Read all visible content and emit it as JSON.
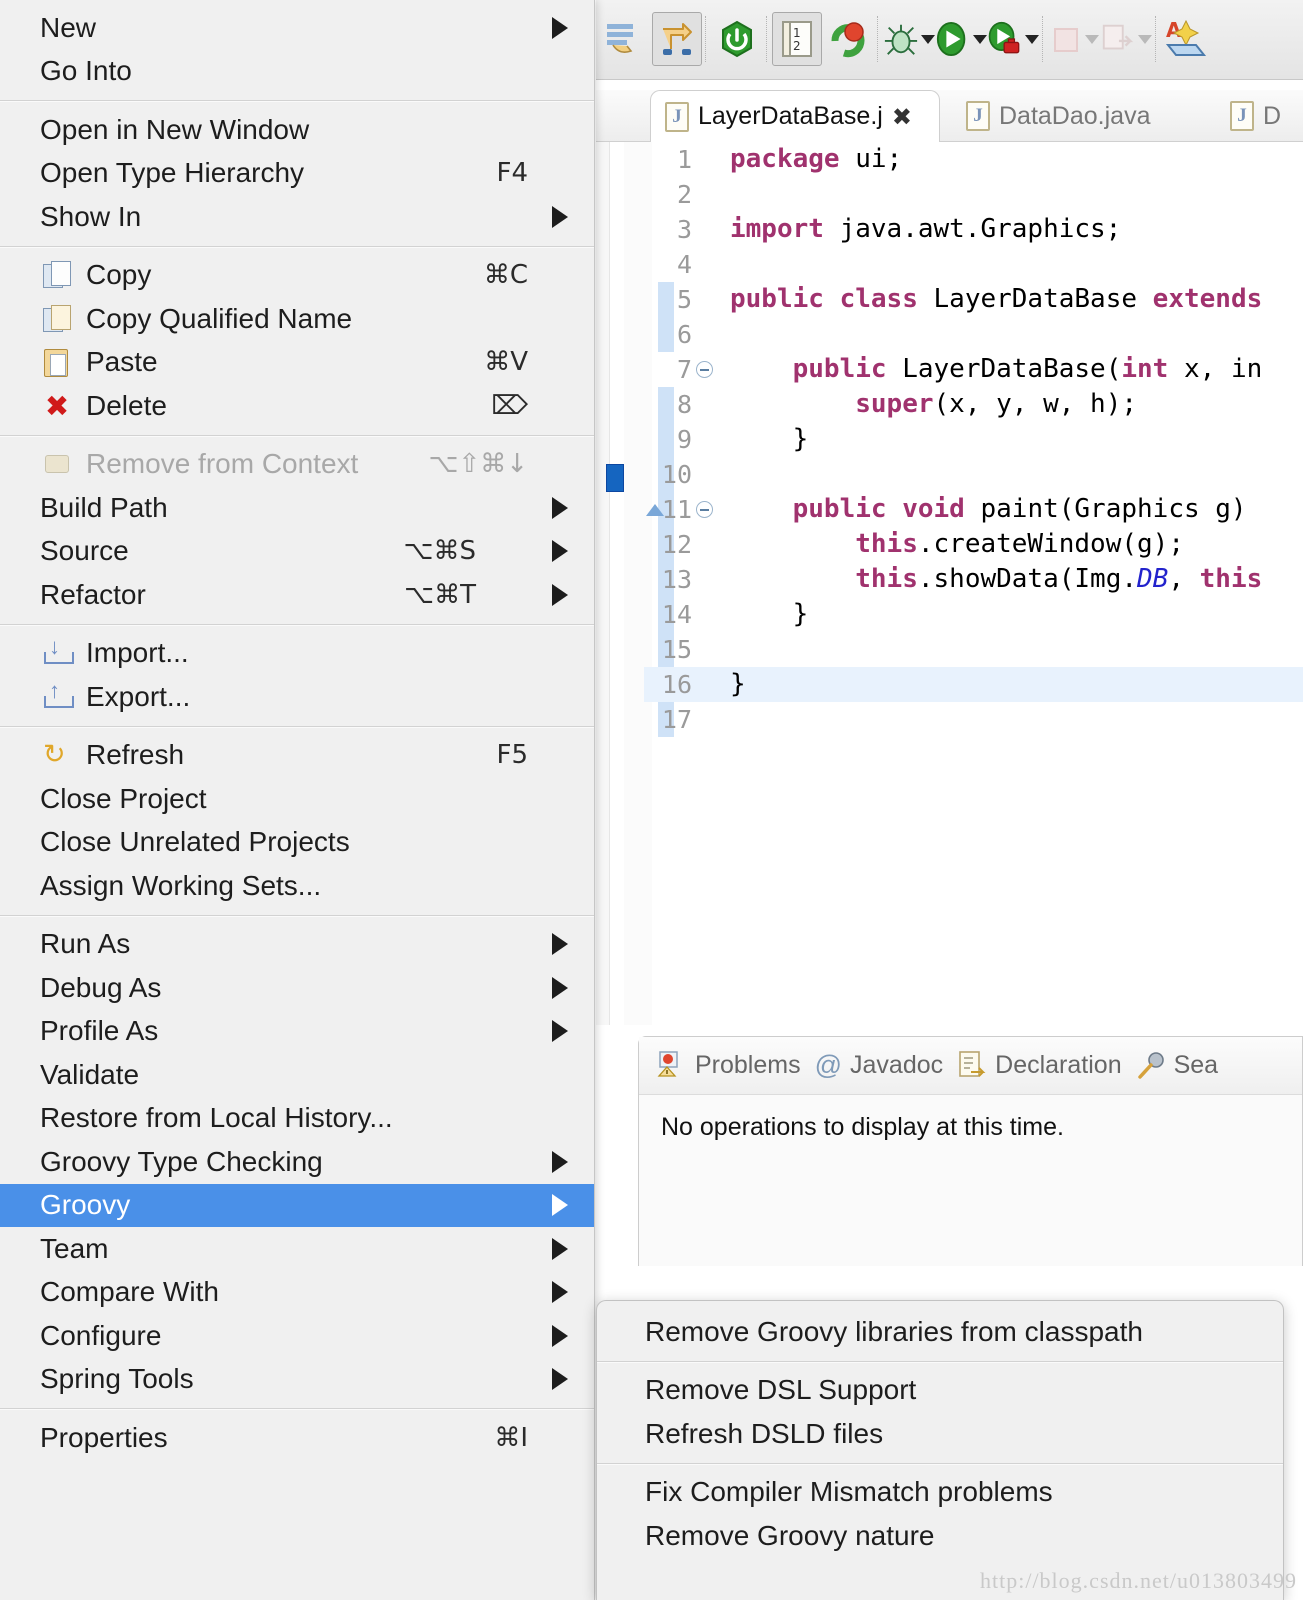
{
  "toolbar": {
    "buttons": [
      {
        "name": "skip-breakpoints-icon",
        "label": ""
      },
      {
        "name": "open-task-icon",
        "label": ""
      },
      {
        "name": "terminate-icon",
        "label": ""
      },
      {
        "name": "new-java-class-icon",
        "label": ""
      },
      {
        "name": "build-icon",
        "label": ""
      },
      {
        "name": "debug-icon",
        "label": ""
      },
      {
        "name": "run-icon",
        "label": ""
      },
      {
        "name": "run-external-tools-icon",
        "label": ""
      },
      {
        "name": "stop-icon",
        "label": ""
      },
      {
        "name": "next-annotation-icon",
        "label": ""
      },
      {
        "name": "open-perspective-icon",
        "label": ""
      }
    ]
  },
  "editor": {
    "tabs": [
      {
        "label": "LayerDataBase.j",
        "active": true,
        "closable": true
      },
      {
        "label": "DataDao.java",
        "active": false,
        "closable": false
      },
      {
        "label": "D",
        "active": false,
        "closable": false
      }
    ],
    "lines": [
      {
        "num": "1",
        "html": "<span class='kw'>package</span> ui;"
      },
      {
        "num": "2",
        "html": ""
      },
      {
        "num": "3",
        "html": "<span class='kw'>import</span> java.awt.Graphics;"
      },
      {
        "num": "4",
        "html": ""
      },
      {
        "num": "5",
        "html": "<span class='kw'>public</span> <span class='kw'>class</span> LayerDataBase <span class='kw'>extends</span>"
      },
      {
        "num": "6",
        "html": ""
      },
      {
        "num": "7",
        "html": "    <span class='kw'>public</span> LayerDataBase(<span class='kw'>int</span> x, in"
      },
      {
        "num": "8",
        "html": "        <span class='kw'>super</span>(x, y, w, h);"
      },
      {
        "num": "9",
        "html": "    }"
      },
      {
        "num": "10",
        "html": ""
      },
      {
        "num": "11",
        "html": "    <span class='kw'>public</span> <span class='kw'>void</span> paint(Graphics g)"
      },
      {
        "num": "12",
        "html": "        <span class='kw'>this</span>.createWindow(g);"
      },
      {
        "num": "13",
        "html": "        <span class='kw'>this</span>.showData(Img.<span class='fld'>DB</span>, <span class='kw'>this</span>"
      },
      {
        "num": "14",
        "html": "    }"
      },
      {
        "num": "15",
        "html": ""
      },
      {
        "num": "16",
        "html": "}"
      },
      {
        "num": "17",
        "html": ""
      }
    ]
  },
  "bottom_panel": {
    "tabs": [
      {
        "label": "Problems",
        "icon": "problems-icon"
      },
      {
        "label": "Javadoc",
        "icon": "javadoc-icon"
      },
      {
        "label": "Declaration",
        "icon": "declaration-icon"
      },
      {
        "label": "Sea",
        "icon": "search-icon"
      }
    ],
    "message": "No operations to display at this time."
  },
  "context_menu": {
    "groups": [
      {
        "items": [
          {
            "label": "New",
            "accel": "",
            "arrow": true,
            "icon": null,
            "disabled": false,
            "selected": false
          },
          {
            "label": "Go Into",
            "accel": "",
            "arrow": false,
            "icon": null,
            "disabled": false,
            "selected": false
          }
        ]
      },
      {
        "items": [
          {
            "label": "Open in New Window",
            "accel": "",
            "arrow": false,
            "icon": null,
            "disabled": false,
            "selected": false
          },
          {
            "label": "Open Type Hierarchy",
            "accel": "F4",
            "arrow": false,
            "icon": null,
            "disabled": false,
            "selected": false
          },
          {
            "label": "Show In",
            "accel": "",
            "arrow": true,
            "icon": null,
            "disabled": false,
            "selected": false
          }
        ]
      },
      {
        "items": [
          {
            "label": "Copy",
            "accel": "⌘C",
            "arrow": false,
            "icon": "copy-icon",
            "disabled": false,
            "selected": false
          },
          {
            "label": "Copy Qualified Name",
            "accel": "",
            "arrow": false,
            "icon": "copy-qualified-name-icon",
            "disabled": false,
            "selected": false
          },
          {
            "label": "Paste",
            "accel": "⌘V",
            "arrow": false,
            "icon": "paste-icon",
            "disabled": false,
            "selected": false
          },
          {
            "label": "Delete",
            "accel": "⌦",
            "arrow": false,
            "icon": "delete-icon",
            "disabled": false,
            "selected": false
          }
        ]
      },
      {
        "items": [
          {
            "label": "Remove from Context",
            "accel": "⌥⇧⌘↓",
            "arrow": false,
            "icon": "remove-from-context-icon",
            "disabled": true,
            "selected": false
          },
          {
            "label": "Build Path",
            "accel": "",
            "arrow": true,
            "icon": null,
            "disabled": false,
            "selected": false
          },
          {
            "label": "Source",
            "accel": "⌥⌘S",
            "arrow": true,
            "icon": null,
            "disabled": false,
            "selected": false
          },
          {
            "label": "Refactor",
            "accel": "⌥⌘T",
            "arrow": true,
            "icon": null,
            "disabled": false,
            "selected": false
          }
        ]
      },
      {
        "items": [
          {
            "label": "Import...",
            "accel": "",
            "arrow": false,
            "icon": "import-icon",
            "disabled": false,
            "selected": false
          },
          {
            "label": "Export...",
            "accel": "",
            "arrow": false,
            "icon": "export-icon",
            "disabled": false,
            "selected": false
          }
        ]
      },
      {
        "items": [
          {
            "label": "Refresh",
            "accel": "F5",
            "arrow": false,
            "icon": "refresh-icon",
            "disabled": false,
            "selected": false
          },
          {
            "label": "Close Project",
            "accel": "",
            "arrow": false,
            "icon": null,
            "disabled": false,
            "selected": false
          },
          {
            "label": "Close Unrelated Projects",
            "accel": "",
            "arrow": false,
            "icon": null,
            "disabled": false,
            "selected": false
          },
          {
            "label": "Assign Working Sets...",
            "accel": "",
            "arrow": false,
            "icon": null,
            "disabled": false,
            "selected": false
          }
        ]
      },
      {
        "items": [
          {
            "label": "Run As",
            "accel": "",
            "arrow": true,
            "icon": null,
            "disabled": false,
            "selected": false
          },
          {
            "label": "Debug As",
            "accel": "",
            "arrow": true,
            "icon": null,
            "disabled": false,
            "selected": false
          },
          {
            "label": "Profile As",
            "accel": "",
            "arrow": true,
            "icon": null,
            "disabled": false,
            "selected": false
          },
          {
            "label": "Validate",
            "accel": "",
            "arrow": false,
            "icon": null,
            "disabled": false,
            "selected": false
          },
          {
            "label": "Restore from Local History...",
            "accel": "",
            "arrow": false,
            "icon": null,
            "disabled": false,
            "selected": false
          },
          {
            "label": "Groovy Type Checking",
            "accel": "",
            "arrow": true,
            "icon": null,
            "disabled": false,
            "selected": false
          },
          {
            "label": "Groovy",
            "accel": "",
            "arrow": true,
            "icon": null,
            "disabled": false,
            "selected": true
          },
          {
            "label": "Team",
            "accel": "",
            "arrow": true,
            "icon": null,
            "disabled": false,
            "selected": false
          },
          {
            "label": "Compare With",
            "accel": "",
            "arrow": true,
            "icon": null,
            "disabled": false,
            "selected": false
          },
          {
            "label": "Configure",
            "accel": "",
            "arrow": true,
            "icon": null,
            "disabled": false,
            "selected": false
          },
          {
            "label": "Spring Tools",
            "accel": "",
            "arrow": true,
            "icon": null,
            "disabled": false,
            "selected": false
          }
        ]
      },
      {
        "items": [
          {
            "label": "Properties",
            "accel": "⌘I",
            "arrow": false,
            "icon": null,
            "disabled": false,
            "selected": false
          }
        ]
      }
    ]
  },
  "submenu": {
    "groups": [
      {
        "items": [
          {
            "label": "Remove Groovy libraries from classpath"
          }
        ]
      },
      {
        "items": [
          {
            "label": "Remove DSL Support"
          },
          {
            "label": "Refresh DSLD files"
          }
        ]
      },
      {
        "items": [
          {
            "label": "Fix Compiler Mismatch problems"
          },
          {
            "label": "Remove Groovy nature"
          }
        ]
      }
    ]
  },
  "watermark": "http://blog.csdn.net/u013803499",
  "colors": {
    "menu_bg": "#f0f0f0",
    "highlight": "#4a90e8",
    "keyword": "#a0326e",
    "field": "#2222cc",
    "selection_row": "#e8f2fd",
    "marker_blue": "#1565c0"
  }
}
